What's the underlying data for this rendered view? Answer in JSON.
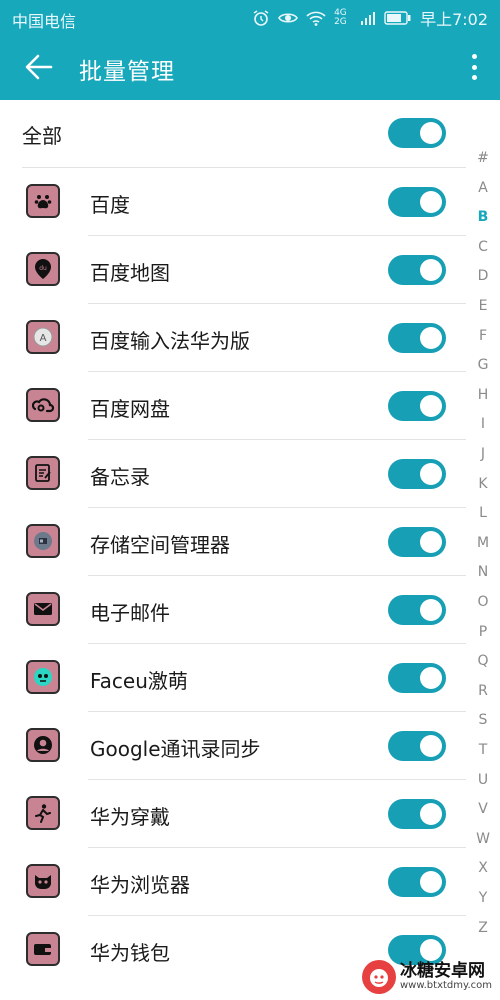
{
  "status_bar": {
    "carrier": "中国电信",
    "time": "早上7:02",
    "icons": [
      "alarm-icon",
      "eye-icon",
      "wifi-icon",
      "signal-icon",
      "battery-icon"
    ],
    "network": "4G 2G"
  },
  "toolbar": {
    "title": "批量管理",
    "back_icon": "arrow-left-icon",
    "more_icon": "more-vertical-icon"
  },
  "all_row": {
    "label": "全部",
    "enabled": true
  },
  "apps": [
    {
      "label": "百度",
      "icon": "baidu-paw-icon",
      "enabled": true
    },
    {
      "label": "百度地图",
      "icon": "baidu-map-icon",
      "enabled": true
    },
    {
      "label": "百度输入法华为版",
      "icon": "baidu-input-icon",
      "enabled": true
    },
    {
      "label": "百度网盘",
      "icon": "baidu-netdisk-icon",
      "enabled": true
    },
    {
      "label": "备忘录",
      "icon": "memo-icon",
      "enabled": true
    },
    {
      "label": "存储空间管理器",
      "icon": "storage-icon",
      "enabled": true
    },
    {
      "label": "电子邮件",
      "icon": "mail-icon",
      "enabled": true
    },
    {
      "label": "Faceu激萌",
      "icon": "faceu-icon",
      "enabled": true
    },
    {
      "label": "Google通讯录同步",
      "icon": "contact-icon",
      "enabled": true
    },
    {
      "label": "华为穿戴",
      "icon": "wear-icon",
      "enabled": true
    },
    {
      "label": "华为浏览器",
      "icon": "browser-icon",
      "enabled": true
    },
    {
      "label": "华为钱包",
      "icon": "wallet-icon",
      "enabled": true
    }
  ],
  "index_letters": [
    "#",
    "A",
    "B",
    "C",
    "D",
    "E",
    "F",
    "G",
    "H",
    "I",
    "J",
    "K",
    "L",
    "M",
    "N",
    "O",
    "P",
    "Q",
    "R",
    "S",
    "T",
    "U",
    "V",
    "W",
    "X",
    "Y",
    "Z"
  ],
  "active_letter": "B",
  "watermark": {
    "name": "冰糖安卓网",
    "url": "www.btxtdmy.com"
  },
  "colors": {
    "accent": "#17a8bc",
    "toggle": "#17a0b5",
    "icon_bg": "#c98493"
  }
}
